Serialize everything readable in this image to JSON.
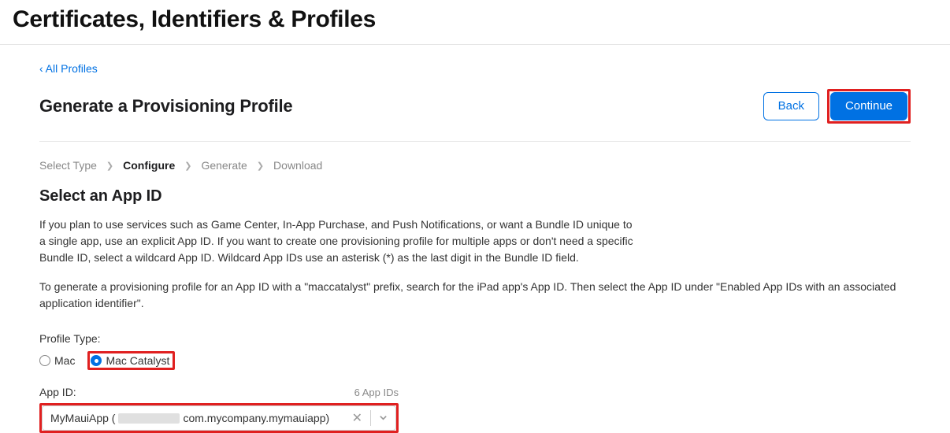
{
  "header": {
    "title": "Certificates, Identifiers & Profiles"
  },
  "back_link": {
    "text": "All Profiles"
  },
  "section": {
    "title": "Generate a Provisioning Profile",
    "back_button": "Back",
    "continue_button": "Continue"
  },
  "breadcrumb": {
    "steps": [
      {
        "label": "Select Type",
        "active": false
      },
      {
        "label": "Configure",
        "active": true
      },
      {
        "label": "Generate",
        "active": false
      },
      {
        "label": "Download",
        "active": false
      }
    ]
  },
  "subsection": {
    "title": "Select an App ID",
    "description1": "If you plan to use services such as Game Center, In-App Purchase, and Push Notifications, or want a Bundle ID unique to a single app, use an explicit App ID. If you want to create one provisioning profile for multiple apps or don't need a specific Bundle ID, select a wildcard App ID. Wildcard App IDs use an asterisk (*) as the last digit in the Bundle ID field.",
    "description2": "To generate a provisioning profile for an App ID with a \"maccatalyst\" prefix, search for the iPad app's App ID. Then select the App ID under \"Enabled App IDs with an associated application identifier\"."
  },
  "profile_type": {
    "label": "Profile Type:",
    "options": [
      {
        "label": "Mac",
        "checked": false
      },
      {
        "label": "Mac Catalyst",
        "checked": true
      }
    ]
  },
  "app_id": {
    "label": "App ID:",
    "count": "6 App IDs",
    "value_prefix": "MyMauiApp (",
    "value_suffix": "com.mycompany.mymauiapp)"
  }
}
